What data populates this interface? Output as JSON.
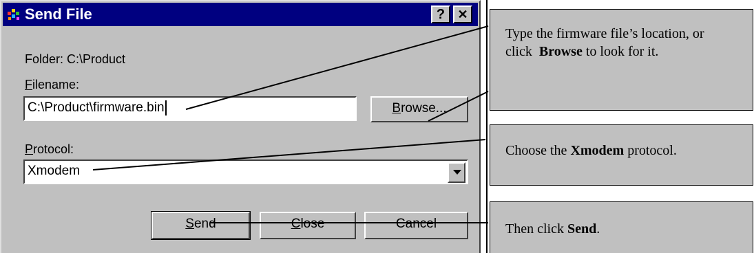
{
  "dialog": {
    "title": "Send File",
    "help_glyph": "?",
    "close_glyph": "✕",
    "folder_label": "Folder:  C:\\Product",
    "filename": {
      "label_accel": "F",
      "label_rest": "ilename:",
      "value": "C:\\Product\\firmware.bin"
    },
    "browse": {
      "accel": "B",
      "rest": "rowse..."
    },
    "protocol": {
      "label_accel": "P",
      "label_rest": "rotocol:",
      "value": "Xmodem"
    },
    "buttons": {
      "send": {
        "accel": "S",
        "rest": "end"
      },
      "close": {
        "accel": "C",
        "rest": "lose"
      },
      "cancel": "Cancel"
    }
  },
  "callouts": {
    "filename": {
      "part1": "Type the firmware file’s location, or click",
      "bold": "Browse",
      "part2": " to look for it."
    },
    "protocol": {
      "part1": "Choose the ",
      "bold": "Xmodem",
      "part2": " protocol."
    },
    "send": {
      "part1": "Then click ",
      "bold": "Send",
      "part2": "."
    }
  },
  "colors": {
    "titlebar": "#000080",
    "dialog_face": "#c0c0c0",
    "callout_face": "#c0c0c0"
  },
  "icons": [
    "app-icon",
    "help-icon",
    "close-icon",
    "dropdown-arrow-icon"
  ]
}
